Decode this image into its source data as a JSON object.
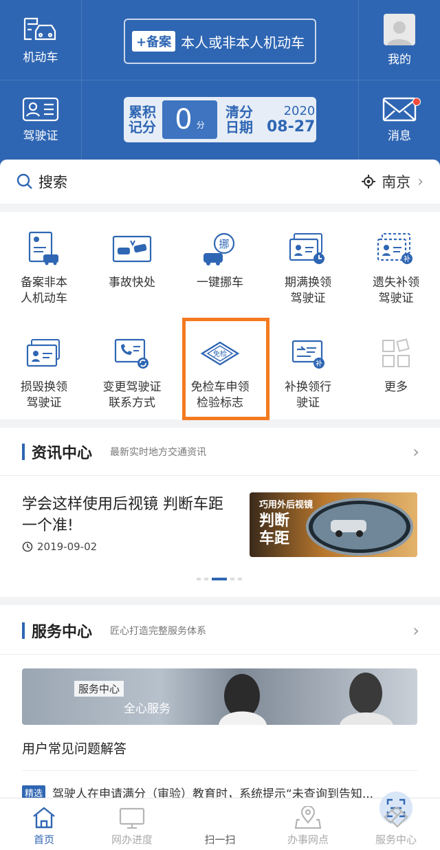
{
  "header": {
    "vehicle_label": "机动车",
    "license_label": "驾驶证",
    "register": {
      "tag": "+备案",
      "text": "本人或非本人机动车"
    },
    "score": {
      "label": "累积记分",
      "value": "0",
      "unit": "分"
    },
    "clear_date": {
      "label": "清分日期",
      "year": "2020",
      "date": "08-27"
    },
    "mine_label": "我的",
    "messages_label": "消息"
  },
  "search": {
    "placeholder": "搜索",
    "city": "南京"
  },
  "services": [
    {
      "label": "备案非本\n人机动车",
      "icon": "register-vehicle-icon"
    },
    {
      "label": "事故快处",
      "icon": "accident-icon"
    },
    {
      "label": "一键挪车",
      "icon": "move-car-icon",
      "badge": "挪"
    },
    {
      "label": "期满换领\n驾驶证",
      "icon": "license-renew-icon"
    },
    {
      "label": "遗失补领\n驾驶证",
      "icon": "license-lost-icon",
      "badge": "补"
    },
    {
      "label": "损毁换领\n驾驶证",
      "icon": "license-damaged-icon"
    },
    {
      "label": "变更驾驶证\n联系方式",
      "icon": "contact-change-icon"
    },
    {
      "label": "免检车申领\n检验标志",
      "icon": "inspection-exempt-icon",
      "badge": "免检"
    },
    {
      "label": "补换领行\n驶证",
      "icon": "vehicle-license-icon",
      "badge": "补"
    },
    {
      "label": "更多",
      "icon": "more-icon"
    }
  ],
  "news": {
    "title": "资讯中心",
    "subtitle": "最新实时地方交通资讯",
    "article": {
      "title": "学会这样使用后视镜 判断车距一个准!",
      "date": "2019-09-02",
      "image_text_1": "巧用外后视镜",
      "image_text_2": "判断",
      "image_text_3": "车距"
    }
  },
  "service_center": {
    "title": "服务中心",
    "subtitle": "匠心打造完整服务体系",
    "banner_tag": "服务中心",
    "banner_text": "全心服务",
    "faq": "用户常见问题解答",
    "featured_tag": "精选",
    "featured_text": "驾驶人在申请满分（审验）教育时，系统提示“未查询到告知..."
  },
  "tabs": [
    {
      "label": "首页",
      "icon": "home-icon"
    },
    {
      "label": "网办进度",
      "icon": "monitor-icon"
    },
    {
      "label": "扫一扫",
      "icon": "scan-icon"
    },
    {
      "label": "办事网点",
      "icon": "location-icon"
    },
    {
      "label": "服务中心",
      "icon": "service-icon"
    }
  ],
  "colors": {
    "brand": "#2f66b3",
    "highlight": "#f47a20",
    "badge_red": "#f04b3c"
  }
}
